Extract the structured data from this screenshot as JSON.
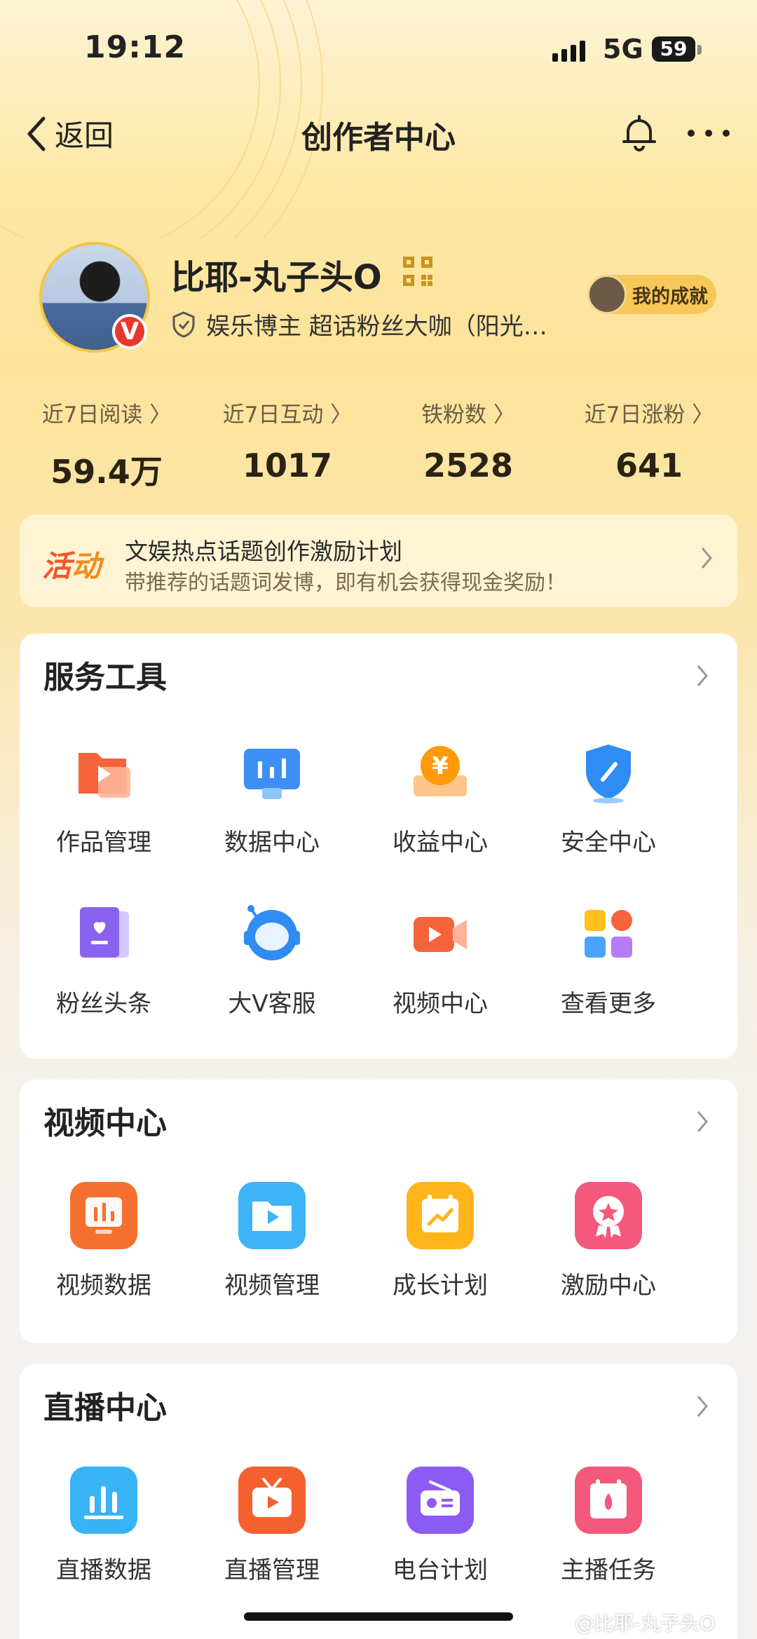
{
  "status_bar": {
    "time": "19:12",
    "network": "5G",
    "battery": "59"
  },
  "nav": {
    "back_label": "返回",
    "title": "创作者中心"
  },
  "profile": {
    "name": "比耶-丸子头O",
    "certification": "娱乐博主 超话粉丝大咖（阳光…",
    "achievement_label": "我的成就"
  },
  "stats": [
    {
      "label": "近7日阅读",
      "value": "59.4万"
    },
    {
      "label": "近7日互动",
      "value": "1017"
    },
    {
      "label": "铁粉数",
      "value": "2528"
    },
    {
      "label": "近7日涨粉",
      "value": "641"
    }
  ],
  "activity": {
    "tag": "活动",
    "title": "文娱热点话题创作激励计划",
    "subtitle": "带推荐的话题词发博，即有机会获得现金奖励！"
  },
  "service_tools": {
    "title": "服务工具",
    "items": [
      {
        "label": "作品管理",
        "icon": "works-folder-icon"
      },
      {
        "label": "数据中心",
        "icon": "data-center-icon"
      },
      {
        "label": "收益中心",
        "icon": "yen-coin-icon"
      },
      {
        "label": "安全中心",
        "icon": "shield-icon"
      },
      {
        "label": "粉丝头条",
        "icon": "fans-heart-icon"
      },
      {
        "label": "大V客服",
        "icon": "astronaut-service-icon"
      },
      {
        "label": "视频中心",
        "icon": "video-camera-icon"
      },
      {
        "label": "查看更多",
        "icon": "more-grid-icon"
      }
    ]
  },
  "video_center": {
    "title": "视频中心",
    "items": [
      {
        "label": "视频数据",
        "icon": "video-data-icon"
      },
      {
        "label": "视频管理",
        "icon": "video-manage-icon"
      },
      {
        "label": "成长计划",
        "icon": "growth-plan-icon"
      },
      {
        "label": "激励中心",
        "icon": "incentive-medal-icon"
      }
    ]
  },
  "live_center": {
    "title": "直播中心",
    "items": [
      {
        "label": "直播数据",
        "icon": "live-data-icon"
      },
      {
        "label": "直播管理",
        "icon": "live-tv-icon"
      },
      {
        "label": "电台计划",
        "icon": "radio-icon"
      },
      {
        "label": "主播任务",
        "icon": "host-task-icon"
      }
    ]
  },
  "watermark": "@比耶-丸子头O"
}
